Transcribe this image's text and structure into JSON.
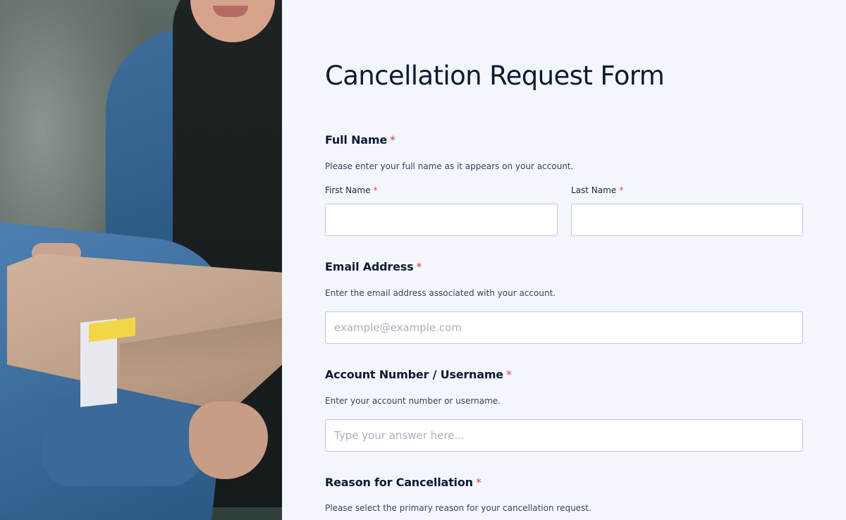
{
  "form": {
    "title": "Cancellation Request Form",
    "required_marker": "*",
    "full_name": {
      "label": "Full Name",
      "description": "Please enter your full name as it appears on your account.",
      "first_name_label": "First Name",
      "first_name_value": "",
      "last_name_label": "Last Name",
      "last_name_value": ""
    },
    "email": {
      "label": "Email Address",
      "description": "Enter the email address associated with your account.",
      "placeholder": "example@example.com",
      "value": ""
    },
    "account": {
      "label": "Account Number / Username",
      "description": "Enter your account number or username.",
      "placeholder": "Type your answer here...",
      "value": ""
    },
    "reason": {
      "label": "Reason for Cancellation",
      "description": "Please select the primary reason for your cancellation request."
    }
  },
  "colors": {
    "background": "#f3f6fd",
    "title": "#0e1a33",
    "required": "#e23d3d",
    "input_border": "#c3c9d6"
  }
}
